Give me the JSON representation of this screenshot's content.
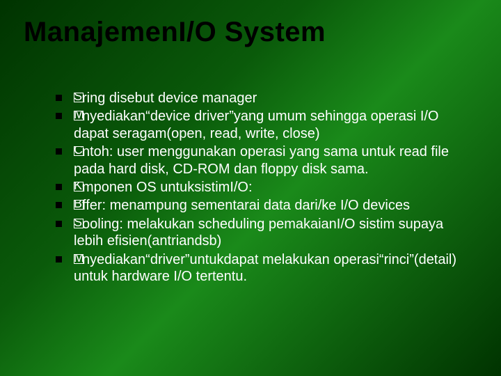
{
  "title": "ManajemenI/O System",
  "bullets": [
    {
      "boxChars": "Se",
      "rest": "ring disebut device manager"
    },
    {
      "boxChars": "Me",
      "rest": "nyediakan“device driver”yang umum sehingga operasi I/O dapat seragam(open, read, write, close)"
    },
    {
      "boxChars": "Co",
      "rest": "ntoh: user menggunakan operasi yang sama untuk read file pada hard disk, CD-ROM dan  floppy disk sama."
    },
    {
      "boxChars": "Ko",
      "rest": "mponen OS untuksistimI/O:"
    },
    {
      "boxChars": "Bu",
      "rest": "ffer: menampung sementarai data dari/ke I/O devices"
    },
    {
      "boxChars": "Sp",
      "rest": "ooling: melakukan scheduling pemakaianI/O sistim supaya lebih efisien(antriandsb)"
    },
    {
      "boxChars": "Me",
      "rest": "nyediakan“driver”untukdapat melakukan operasi“rinci”(detail) untuk hardware I/O tertentu."
    }
  ]
}
